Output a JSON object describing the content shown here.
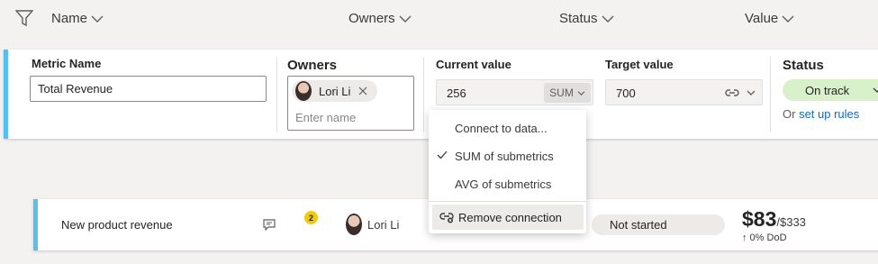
{
  "header": {
    "columns": [
      "Name",
      "Owners",
      "Status",
      "Value"
    ]
  },
  "editor": {
    "metric_name_label": "Metric Name",
    "metric_name_value": "Total Revenue",
    "owners_label": "Owners",
    "owner_name": "Lori Li",
    "owner_placeholder": "Enter name",
    "current_value_label": "Current value",
    "current_value": "256",
    "aggregation": "SUM",
    "target_value_label": "Target value",
    "target_value": "700",
    "status_label": "Status",
    "status_value": "On track",
    "rules_prefix": "Or",
    "rules_link": "set up rules"
  },
  "dropdown": {
    "items": [
      "Connect to data...",
      "SUM of submetrics",
      "AVG of submetrics"
    ],
    "selected_index": 1,
    "remove_label": "Remove connection"
  },
  "row": {
    "name": "New product revenue",
    "comment_count": "2",
    "owner": "Lori Li",
    "status": "Not started",
    "value": "$83",
    "target": "/$333",
    "change": "↑ 0% DoD"
  },
  "colors": {
    "accent": "#56c1ef",
    "on_track": "#d9f1cb",
    "link": "#0f6cbd",
    "badge": "#f2c811"
  },
  "icons": [
    "filter-icon",
    "chevron-down-icon",
    "close-icon",
    "link-icon",
    "checkmark-icon",
    "unlink-icon",
    "comment-icon"
  ]
}
